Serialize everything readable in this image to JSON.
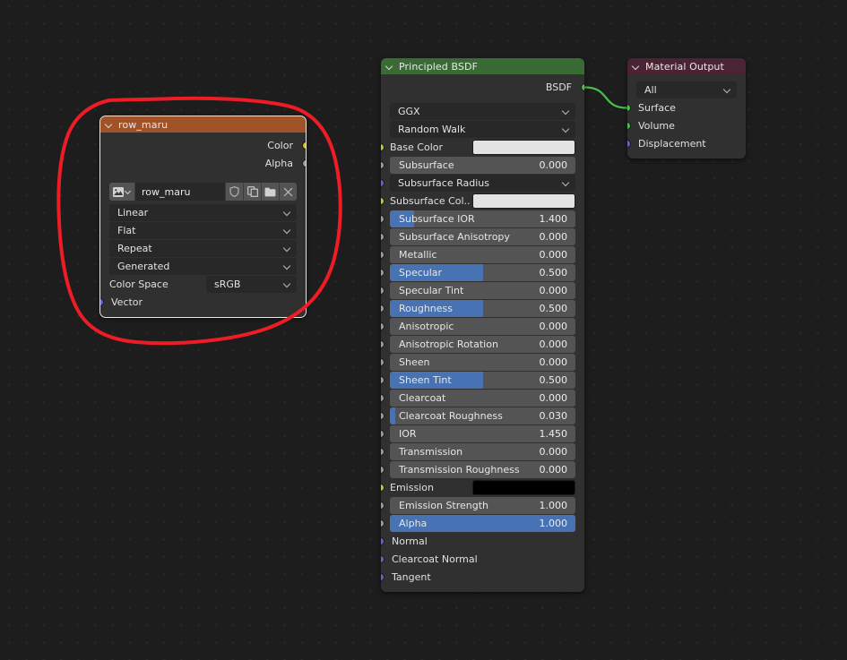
{
  "editor": {
    "background_color": "#1d1d1d",
    "grid_dot_color": "#272727"
  },
  "annotation": {
    "name": "red-circle-annotation",
    "color": "#ee1c24",
    "stroke_width": 4
  },
  "link": {
    "color": "#49c04a",
    "from": "Principled BSDF : BSDF",
    "to": "Material Output : Surface"
  },
  "image_texture_node": {
    "title": "row_maru",
    "header_color": "#a05228",
    "selected": true,
    "outputs": [
      {
        "label": "Color",
        "socket": "sock-color"
      },
      {
        "label": "Alpha",
        "socket": "sock-float"
      }
    ],
    "datablock": {
      "icon": "image-icon",
      "dropdown_icon": "chevron-down-icon",
      "name": "row_maru",
      "buttons": [
        {
          "icon": "shield-icon",
          "name": "fake-user-button"
        },
        {
          "icon": "duplicate-icon",
          "name": "new-image-button"
        },
        {
          "icon": "folder-icon",
          "name": "open-image-button"
        },
        {
          "icon": "x-icon",
          "name": "unlink-image-button"
        }
      ]
    },
    "enums": [
      {
        "name": "interpolation",
        "value": "Linear"
      },
      {
        "name": "projection",
        "value": "Flat"
      },
      {
        "name": "extension",
        "value": "Repeat"
      },
      {
        "name": "source",
        "value": "Generated"
      }
    ],
    "color_space": {
      "label": "Color Space",
      "value": "sRGB"
    },
    "inputs": [
      {
        "label": "Vector",
        "socket": "sock-vector"
      }
    ]
  },
  "principled_node": {
    "title": "Principled BSDF",
    "header_color": "#3a6b34",
    "outputs": [
      {
        "label": "BSDF",
        "socket": "sock-shader"
      }
    ],
    "enums": [
      {
        "name": "distribution",
        "value": "GGX"
      },
      {
        "name": "subsurface-method",
        "value": "Random Walk"
      }
    ],
    "rows": [
      {
        "type": "swatch",
        "label": "Base Color",
        "socket": "sock-color",
        "color": "#e3e3e3"
      },
      {
        "type": "slider",
        "label": "Subsurface",
        "socket": "sock-float",
        "value": "0.000",
        "fill": 0
      },
      {
        "type": "dropdown",
        "label": "Subsurface Radius",
        "socket": "sock-vector"
      },
      {
        "type": "swatch",
        "label": "Subsurface Col..",
        "socket": "sock-color",
        "color": "#e3e3e3"
      },
      {
        "type": "slider",
        "label": "Subsurface IOR",
        "socket": "sock-float",
        "value": "1.400",
        "fill": 13
      },
      {
        "type": "slider",
        "label": "Subsurface Anisotropy",
        "socket": "sock-float",
        "value": "0.000",
        "fill": 0
      },
      {
        "type": "slider",
        "label": "Metallic",
        "socket": "sock-float",
        "value": "0.000",
        "fill": 0
      },
      {
        "type": "slider",
        "label": "Specular",
        "socket": "sock-float",
        "value": "0.500",
        "fill": 50
      },
      {
        "type": "slider",
        "label": "Specular Tint",
        "socket": "sock-float",
        "value": "0.000",
        "fill": 0
      },
      {
        "type": "slider",
        "label": "Roughness",
        "socket": "sock-float",
        "value": "0.500",
        "fill": 50
      },
      {
        "type": "slider",
        "label": "Anisotropic",
        "socket": "sock-float",
        "value": "0.000",
        "fill": 0
      },
      {
        "type": "slider",
        "label": "Anisotropic Rotation",
        "socket": "sock-float",
        "value": "0.000",
        "fill": 0
      },
      {
        "type": "slider",
        "label": "Sheen",
        "socket": "sock-float",
        "value": "0.000",
        "fill": 0
      },
      {
        "type": "slider",
        "label": "Sheen Tint",
        "socket": "sock-float",
        "value": "0.500",
        "fill": 50
      },
      {
        "type": "slider",
        "label": "Clearcoat",
        "socket": "sock-float",
        "value": "0.000",
        "fill": 0
      },
      {
        "type": "slider",
        "label": "Clearcoat Roughness",
        "socket": "sock-float",
        "value": "0.030",
        "fill": 3
      },
      {
        "type": "slider",
        "label": "IOR",
        "socket": "sock-float",
        "value": "1.450",
        "fill": 0
      },
      {
        "type": "slider",
        "label": "Transmission",
        "socket": "sock-float",
        "value": "0.000",
        "fill": 0
      },
      {
        "type": "slider",
        "label": "Transmission Roughness",
        "socket": "sock-float",
        "value": "0.000",
        "fill": 0
      },
      {
        "type": "swatch",
        "label": "Emission",
        "socket": "sock-color",
        "color": "#000000"
      },
      {
        "type": "slider",
        "label": "Emission Strength",
        "socket": "sock-float",
        "value": "1.000",
        "fill": 0
      },
      {
        "type": "slider",
        "label": "Alpha",
        "socket": "sock-float",
        "value": "1.000",
        "fill": 100
      },
      {
        "type": "plain",
        "label": "Normal",
        "socket": "sock-vector"
      },
      {
        "type": "plain",
        "label": "Clearcoat Normal",
        "socket": "sock-vector"
      },
      {
        "type": "plain",
        "label": "Tangent",
        "socket": "sock-vector"
      }
    ]
  },
  "material_output_node": {
    "title": "Material Output",
    "header_color": "#4b2434",
    "target": {
      "name": "target-enum",
      "value": "All"
    },
    "inputs": [
      {
        "label": "Surface",
        "socket": "sock-shader"
      },
      {
        "label": "Volume",
        "socket": "sock-shader"
      },
      {
        "label": "Displacement",
        "socket": "sock-vector"
      }
    ]
  }
}
